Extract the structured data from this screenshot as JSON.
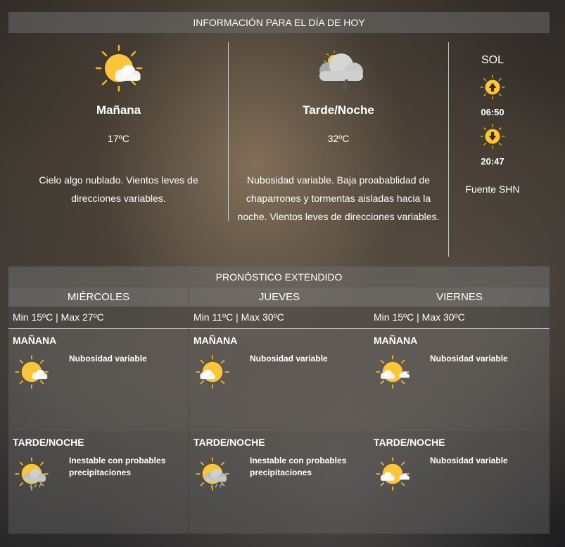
{
  "today": {
    "header": "INFORMACIÓN PARA EL DÍA DE HOY",
    "morning": {
      "title": "Mañana",
      "temp": "17ºC",
      "desc": "Cielo algo nublado. Vientos leves de direcciones variables.",
      "icon": "sun-cloud-icon"
    },
    "evening": {
      "title": "Tarde/Noche",
      "temp": "32ºC",
      "desc": "Nubosidad variable. Baja proabablidad de chaparrones y tormentas aisladas hacia la noche. Vientos leves de direcciones variables.",
      "icon": "storm-cloud-icon"
    },
    "sun": {
      "title": "SOL",
      "sunrise": "06:50",
      "sunset": "20:47",
      "source": "Fuente SHN",
      "sunrise_icon": "sunrise-icon",
      "sunset_icon": "sunset-icon"
    }
  },
  "extended": {
    "header": "PRONÓSTICO EXTENDIDO",
    "days": [
      {
        "name": "MIÉRCOLES",
        "minmax": "Min 15ºC | Max 27ºC",
        "morning": {
          "label": "MAÑANA",
          "desc": "Nubosidad variable",
          "icon": "sun-cloud-icon"
        },
        "evening": {
          "label": "TARDE/NOCHE",
          "desc": "Inestable con probables precipitaciones",
          "icon": "sun-rain-cloud-icon"
        }
      },
      {
        "name": "JUEVES",
        "minmax": "Min 11ºC | Max 30ºC",
        "morning": {
          "label": "MAÑANA",
          "desc": "Nubosidad variable",
          "icon": "sun-cloud-icon"
        },
        "evening": {
          "label": "TARDE/NOCHE",
          "desc": "Inestable con probables precipitaciones",
          "icon": "sun-rain-cloud-icon"
        }
      },
      {
        "name": "VIERNES",
        "minmax": "Min 15ºC | Max 30ºC",
        "morning": {
          "label": "MAÑANA",
          "desc": "Nubosidad variable",
          "icon": "sun-cloud-icon"
        },
        "evening": {
          "label": "TARDE/NOCHE",
          "desc": "Nubosidad variable",
          "icon": "sun-cloud-icon"
        }
      }
    ]
  }
}
